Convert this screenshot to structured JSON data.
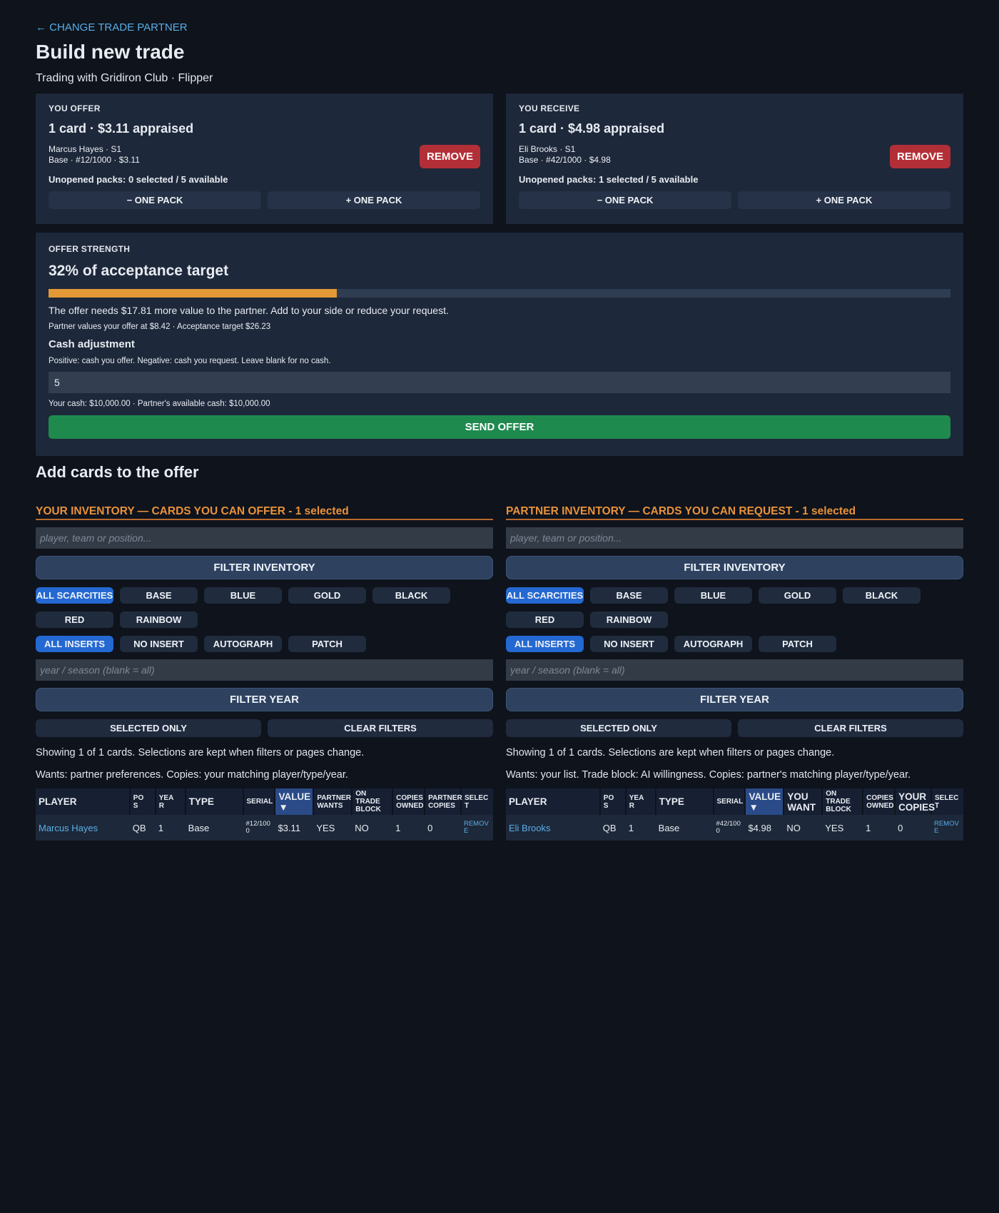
{
  "header": {
    "back_link": "← CHANGE TRADE PARTNER",
    "title": "Build new trade",
    "subtitle": "Trading with Gridiron Club · Flipper"
  },
  "offer": {
    "label": "YOU OFFER",
    "summary": "1 card · $3.11 appraised",
    "card_line1": "Marcus Hayes · S1",
    "card_line2": "Base · #12/1000 · $3.11",
    "remove_label": "REMOVE",
    "packs": "Unopened packs: 0 selected / 5 available",
    "minus_pack": "− ONE PACK",
    "plus_pack": "+ ONE PACK"
  },
  "receive": {
    "label": "YOU RECEIVE",
    "summary": "1 card · $4.98 appraised",
    "card_line1": "Eli Brooks · S1",
    "card_line2": "Base · #42/1000 · $4.98",
    "remove_label": "REMOVE",
    "packs": "Unopened packs: 1 selected / 5 available",
    "minus_pack": "− ONE PACK",
    "plus_pack": "+ ONE PACK"
  },
  "strength": {
    "label": "OFFER STRENGTH",
    "percent_text": "32% of acceptance target",
    "progress": 0.32,
    "progress_color": "#e39a36",
    "need_text": "The offer needs $17.81 more value to the partner. Add to your side or reduce your request.",
    "values_text": "Partner values your offer at $8.42 · Acceptance target $26.23",
    "cash_title": "Cash adjustment",
    "cash_help": "Positive: cash you offer. Negative: cash you request. Leave blank for no cash.",
    "cash_value": "5",
    "cash_balances": "Your cash: $10,000.00 · Partner's available cash: $10,000.00",
    "send_label": "SEND OFFER"
  },
  "add_cards_title": "Add cards to the offer",
  "your_inventory": {
    "title": "YOUR INVENTORY — CARDS YOU CAN OFFER - 1 selected",
    "search_placeholder": "player, team or position...",
    "filter_inventory": "FILTER INVENTORY",
    "scarcities": [
      "ALL SCARCITIES",
      "BASE",
      "BLUE",
      "GOLD",
      "BLACK",
      "RED",
      "RAINBOW"
    ],
    "inserts": [
      "ALL INSERTS",
      "NO INSERT",
      "AUTOGRAPH",
      "PATCH"
    ],
    "year_placeholder": "year / season (blank = all)",
    "filter_year": "FILTER YEAR",
    "selected_only": "SELECTED ONLY",
    "clear_filters": "CLEAR FILTERS",
    "showing": "Showing 1 of 1 cards. Selections are kept when filters or pages change.",
    "legend": "Wants: partner preferences. Copies: your matching player/type/year.",
    "columns": [
      "PLAYER",
      "PO\nS",
      "YEA\nR",
      "TYPE",
      "SERIAL",
      "VALUE\n▼",
      "PARTNER\nWANTS",
      "ON\nTRADE\nBLOCK",
      "COPIES\nOWNED",
      "PARTNER\nCOPIES",
      "SELEC\nT"
    ],
    "rows": [
      [
        "Marcus Hayes",
        "QB",
        "1",
        "Base",
        "#12/1000",
        "$3.11",
        "YES",
        "NO",
        "1",
        "0",
        "REMOVE"
      ]
    ]
  },
  "partner_inventory": {
    "title": "PARTNER INVENTORY — CARDS YOU CAN REQUEST - 1 selected",
    "search_placeholder": "player, team or position...",
    "filter_inventory": "FILTER INVENTORY",
    "scarcities": [
      "ALL SCARCITIES",
      "BASE",
      "BLUE",
      "GOLD",
      "BLACK",
      "RED",
      "RAINBOW"
    ],
    "inserts": [
      "ALL INSERTS",
      "NO INSERT",
      "AUTOGRAPH",
      "PATCH"
    ],
    "year_placeholder": "year / season (blank = all)",
    "filter_year": "FILTER YEAR",
    "selected_only": "SELECTED ONLY",
    "clear_filters": "CLEAR FILTERS",
    "showing": "Showing 1 of 1 cards. Selections are kept when filters or pages change.",
    "legend": "Wants: your list. Trade block: AI willingness. Copies: partner's matching player/type/year.",
    "columns": [
      "PLAYER",
      "PO\nS",
      "YEA\nR",
      "TYPE",
      "SERIAL",
      "VALUE\n▼",
      "YOU\nWANT",
      "ON\nTRADE\nBLOCK",
      "COPIES\nOWNED",
      "YOUR\nCOPIES",
      "SELEC\nT"
    ],
    "rows": [
      [
        "Eli Brooks",
        "QB",
        "1",
        "Base",
        "#42/1000",
        "$4.98",
        "NO",
        "YES",
        "1",
        "0",
        "REMOVE"
      ]
    ]
  },
  "colors": {
    "background": "#0e131c",
    "panel": "#1d283a",
    "accent_orange": "#e9923a",
    "link_blue": "#5aaee6",
    "danger_red": "#b32f37",
    "success_green": "#1f8a4e",
    "active_chip": "#2468d2"
  }
}
